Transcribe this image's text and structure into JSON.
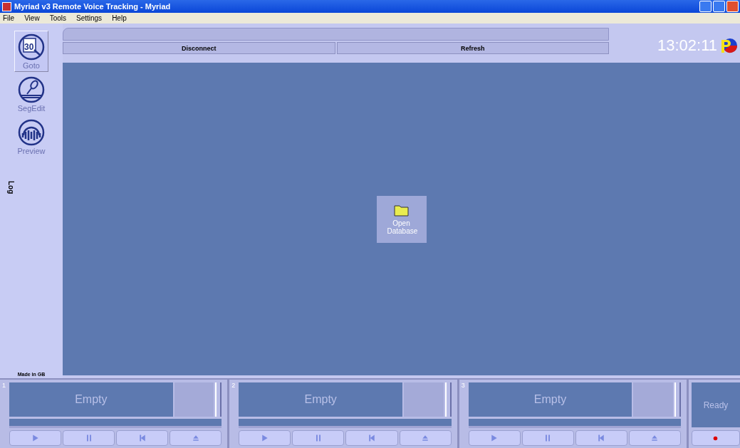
{
  "window": {
    "title": "Myriad v3 Remote Voice Tracking - Myriad"
  },
  "menu": [
    "File",
    "View",
    "Tools",
    "Settings",
    "Help"
  ],
  "sidebar": {
    "tools": [
      {
        "kind": "calendar",
        "icon_text": "30",
        "label": "Goto",
        "selected": true
      },
      {
        "kind": "microphone",
        "label": "SegEdit",
        "selected": false
      },
      {
        "kind": "headphones",
        "label": "Preview",
        "selected": false
      }
    ],
    "log_tab": "Log",
    "footer": "Made in GB"
  },
  "toolbar": {
    "buttons": [
      "Disconnect",
      "Refresh"
    ],
    "clock": "13:02:11"
  },
  "workspace": {
    "open_database": {
      "label": "Open Database"
    }
  },
  "players": [
    {
      "number": "1",
      "title": "Empty"
    },
    {
      "number": "2",
      "title": "Empty"
    },
    {
      "number": "3",
      "title": "Empty"
    }
  ],
  "transport": [
    {
      "kind": "play"
    },
    {
      "kind": "pause"
    },
    {
      "kind": "skip-back"
    },
    {
      "kind": "eject"
    }
  ],
  "recorder": {
    "status": "Ready"
  }
}
